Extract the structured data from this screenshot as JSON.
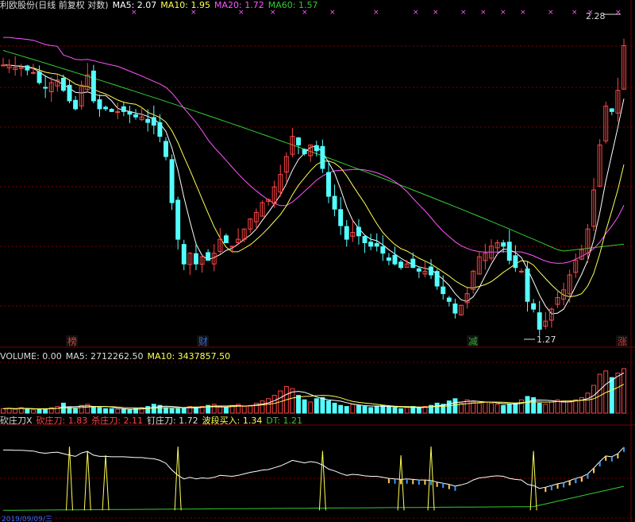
{
  "main_header": [
    {
      "text": "利欧股份(日线 前复权 对数)",
      "color": "#dcdcdc"
    },
    {
      "text": "MA5: 2.07",
      "color": "#ffffff"
    },
    {
      "text": "MA10: 1.95",
      "color": "#ffff55"
    },
    {
      "text": "MA20: 1.72",
      "color": "#ff55ff"
    },
    {
      "text": "MA60: 1.57",
      "color": "#33cc33"
    }
  ],
  "volume_header": [
    {
      "text": "VOLUME: 0.00",
      "color": "#dcdcdc"
    },
    {
      "text": "MA5: 2712262.50",
      "color": "#dcdcdc"
    },
    {
      "text": "MA10: 3437857.50",
      "color": "#ffff55"
    }
  ],
  "ind_header": [
    {
      "text": "砍庄刀X",
      "color": "#dcdcdc"
    },
    {
      "text": "砍庄刀: 1.83",
      "color": "#ff4444"
    },
    {
      "text": "杀庄刀: 2.11",
      "color": "#ff4444"
    },
    {
      "text": "钉庄刀: 1.72",
      "color": "#dcdcdc"
    },
    {
      "text": "波段买入: 1.34",
      "color": "#ffff55"
    },
    {
      "text": "DT: 1.21",
      "color": "#33cc33"
    }
  ],
  "labels": {
    "high_price": "2.28",
    "low_price": "1.27",
    "markers": [
      {
        "text": "榜",
        "color": "#cc4433"
      },
      {
        "text": "财",
        "color": "#3366cc"
      },
      {
        "text": "减",
        "color": "#33aa33"
      },
      {
        "text": "涨",
        "color": "#cc3333"
      }
    ],
    "date_partial": "2019/09/09/三"
  },
  "colors": {
    "up": "#ff4444",
    "down": "#54ffff",
    "ma5": "#ffffff",
    "ma10": "#ffff55",
    "ma20": "#ff55ff",
    "ma60": "#33cc33",
    "grid": "#7a0000"
  },
  "chart_data": {
    "type": "candlestick",
    "price_scale": "log",
    "ylim": [
      1.25,
      2.35
    ],
    "price_path": [
      2.12,
      2.12,
      2.11,
      2.11,
      2.1,
      2.09,
      2.05,
      2.03,
      2.05,
      2.06,
      2.02,
      1.98,
      1.95,
      2.04,
      2.08,
      1.98,
      1.95,
      1.95,
      1.94,
      1.94,
      1.94,
      1.93,
      1.92,
      1.92,
      1.9,
      1.89,
      1.85,
      1.78,
      1.63,
      1.52,
      1.45,
      1.48,
      1.45,
      1.47,
      1.46,
      1.48,
      1.52,
      1.51,
      1.5,
      1.52,
      1.55,
      1.58,
      1.6,
      1.63,
      1.64,
      1.68,
      1.72,
      1.78,
      1.85,
      1.82,
      1.79,
      1.82,
      1.8,
      1.74,
      1.65,
      1.61,
      1.56,
      1.52,
      1.54,
      1.53,
      1.51,
      1.5,
      1.5,
      1.48,
      1.46,
      1.45,
      1.44,
      1.45,
      1.44,
      1.43,
      1.43,
      1.42,
      1.39,
      1.37,
      1.35,
      1.32,
      1.34,
      1.37,
      1.43,
      1.47,
      1.48,
      1.5,
      1.51,
      1.5,
      1.46,
      1.44,
      1.43,
      1.35,
      1.33,
      1.28,
      1.3,
      1.33,
      1.36,
      1.38,
      1.42,
      1.46,
      1.49,
      1.55,
      1.67,
      1.82,
      1.96,
      1.94,
      2.02,
      2.2
    ],
    "vol_path": [
      0.4,
      0.45,
      0.35,
      0.5,
      0.4,
      0.3,
      0.35,
      0.4,
      0.5,
      0.6,
      0.9,
      0.5,
      0.4,
      0.7,
      0.8,
      0.6,
      0.5,
      0.4,
      0.4,
      0.35,
      0.35,
      0.3,
      0.4,
      0.5,
      0.6,
      0.8,
      0.7,
      0.5,
      0.4,
      0.4,
      0.5,
      0.6,
      0.5,
      0.6,
      0.7,
      0.8,
      0.6,
      0.5,
      0.7,
      0.8,
      0.6,
      0.7,
      0.9,
      1.1,
      1.3,
      1.6,
      2.0,
      2.4,
      2.2,
      1.6,
      1.2,
      1.0,
      1.3,
      1.4,
      1.1,
      0.9,
      0.7,
      0.6,
      0.8,
      0.7,
      0.6,
      0.5,
      0.6,
      0.7,
      0.6,
      0.5,
      0.4,
      0.5,
      0.6,
      0.5,
      0.6,
      0.7,
      0.9,
      0.8,
      1.1,
      1.3,
      0.9,
      1.2,
      1.0,
      0.9,
      1.0,
      0.9,
      0.8,
      0.7,
      0.8,
      0.9,
      1.2,
      1.5,
      1.4,
      0.9,
      0.8,
      1.0,
      1.2,
      1.1,
      1.0,
      1.2,
      1.4,
      1.8,
      2.5,
      3.5,
      3.8,
      3.2,
      3.6,
      4.0
    ]
  }
}
